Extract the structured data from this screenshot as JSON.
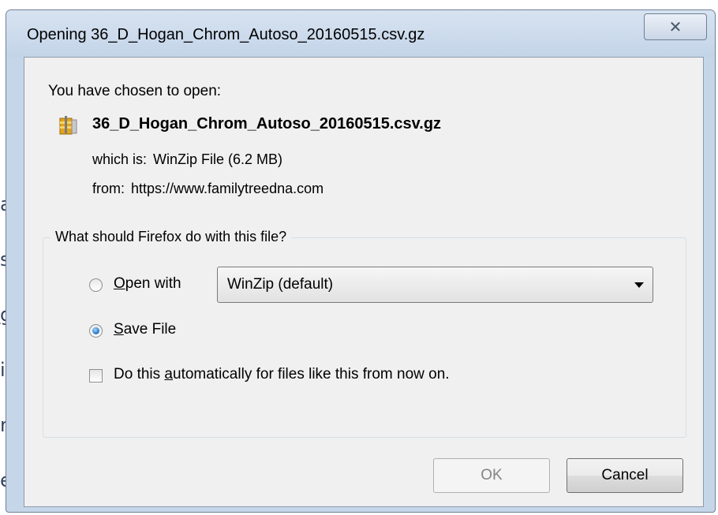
{
  "dialog": {
    "title": "Opening 36_D_Hogan_Chrom_Autoso_20160515.csv.gz",
    "close_glyph": "✕"
  },
  "file_info": {
    "chosen_label": "You have chosen to open:",
    "file_name": "36_D_Hogan_Chrom_Autoso_20160515.csv.gz",
    "type_label": "which is:",
    "type_value": "WinZip File (6.2 MB)",
    "from_label": "from:",
    "from_value": "https://www.familytreedna.com",
    "file_icon": "winzip-archive-icon"
  },
  "action_group": {
    "legend": "What should Firefox do with this file?",
    "open_with": {
      "label_prefix": "",
      "accel": "O",
      "label_rest": "pen with",
      "selected": false
    },
    "app_select": {
      "value": "WinZip (default)"
    },
    "save_file": {
      "accel": "S",
      "label_rest": "ave File",
      "selected": true
    },
    "auto_checkbox": {
      "label_before": "Do this ",
      "accel": "a",
      "label_after": "utomatically for files like this from now on.",
      "checked": false
    }
  },
  "buttons": {
    "ok_label": "OK",
    "cancel_label": "Cancel"
  }
}
